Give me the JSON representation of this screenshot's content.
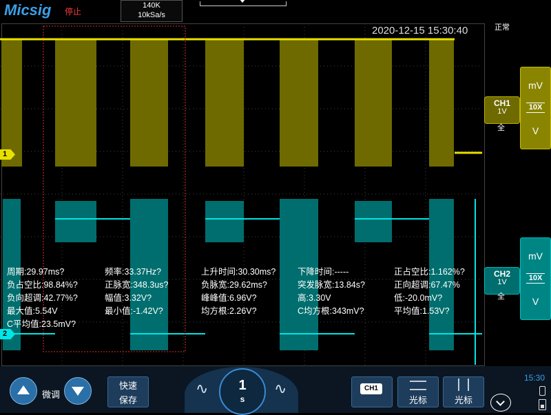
{
  "header": {
    "logo": "Micsig",
    "run_state": "停止",
    "memory_depth": "140K",
    "sample_rate": "10kSa/s",
    "trigger_status": "正常",
    "timestamp": "2020-12-15 15:30:40"
  },
  "channels": {
    "ch1": {
      "label": "CH1",
      "scale": "1V",
      "coupling": "全",
      "marker": "1",
      "probe": "10X",
      "unit_mv": "mV",
      "unit_v": "V",
      "color": "#e8e000"
    },
    "ch2": {
      "label": "CH2",
      "scale": "1V",
      "coupling": "全",
      "marker": "2",
      "probe": "10X",
      "unit_mv": "mV",
      "unit_v": "V",
      "color": "#00e6e6"
    }
  },
  "measurements": [
    [
      "周期:29.97ms?",
      "频率:33.37Hz?",
      "上升时间:30.30ms?",
      "下降时间:-----",
      "正占空比:1.162%?"
    ],
    [
      "负占空比:98.84%?",
      "正脉宽:348.3us?",
      "负脉宽:29.62ms?",
      "突发脉宽:13.84s?",
      "正向超调:67.47%"
    ],
    [
      "负向超调:42.77%?",
      "幅值:3.32V?",
      "峰峰值:6.96V?",
      "高:3.30V",
      "低:-20.0mV?"
    ],
    [
      "最大值:5.54V",
      "最小值:-1.42V?",
      "均方根:2.26V?",
      "C均方根:343mV?",
      "平均值:1.53V?"
    ],
    [
      "C平均值:23.5mV?"
    ]
  ],
  "bottom": {
    "fine_tune": "微调",
    "quick_save_1": "快速",
    "quick_save_2": "保存",
    "timebase_value": "1",
    "timebase_unit": "s",
    "ch1_chip": "CH1",
    "cursor_label_1": "光标",
    "cursor_label_2": "光标",
    "clock": "15:30",
    "wavy_left": "∿",
    "wavy_right": "∿"
  },
  "icons": [
    "up-arrow-icon",
    "down-arrow-icon",
    "usb-icon",
    "battery-icon",
    "chevron-down-icon"
  ]
}
